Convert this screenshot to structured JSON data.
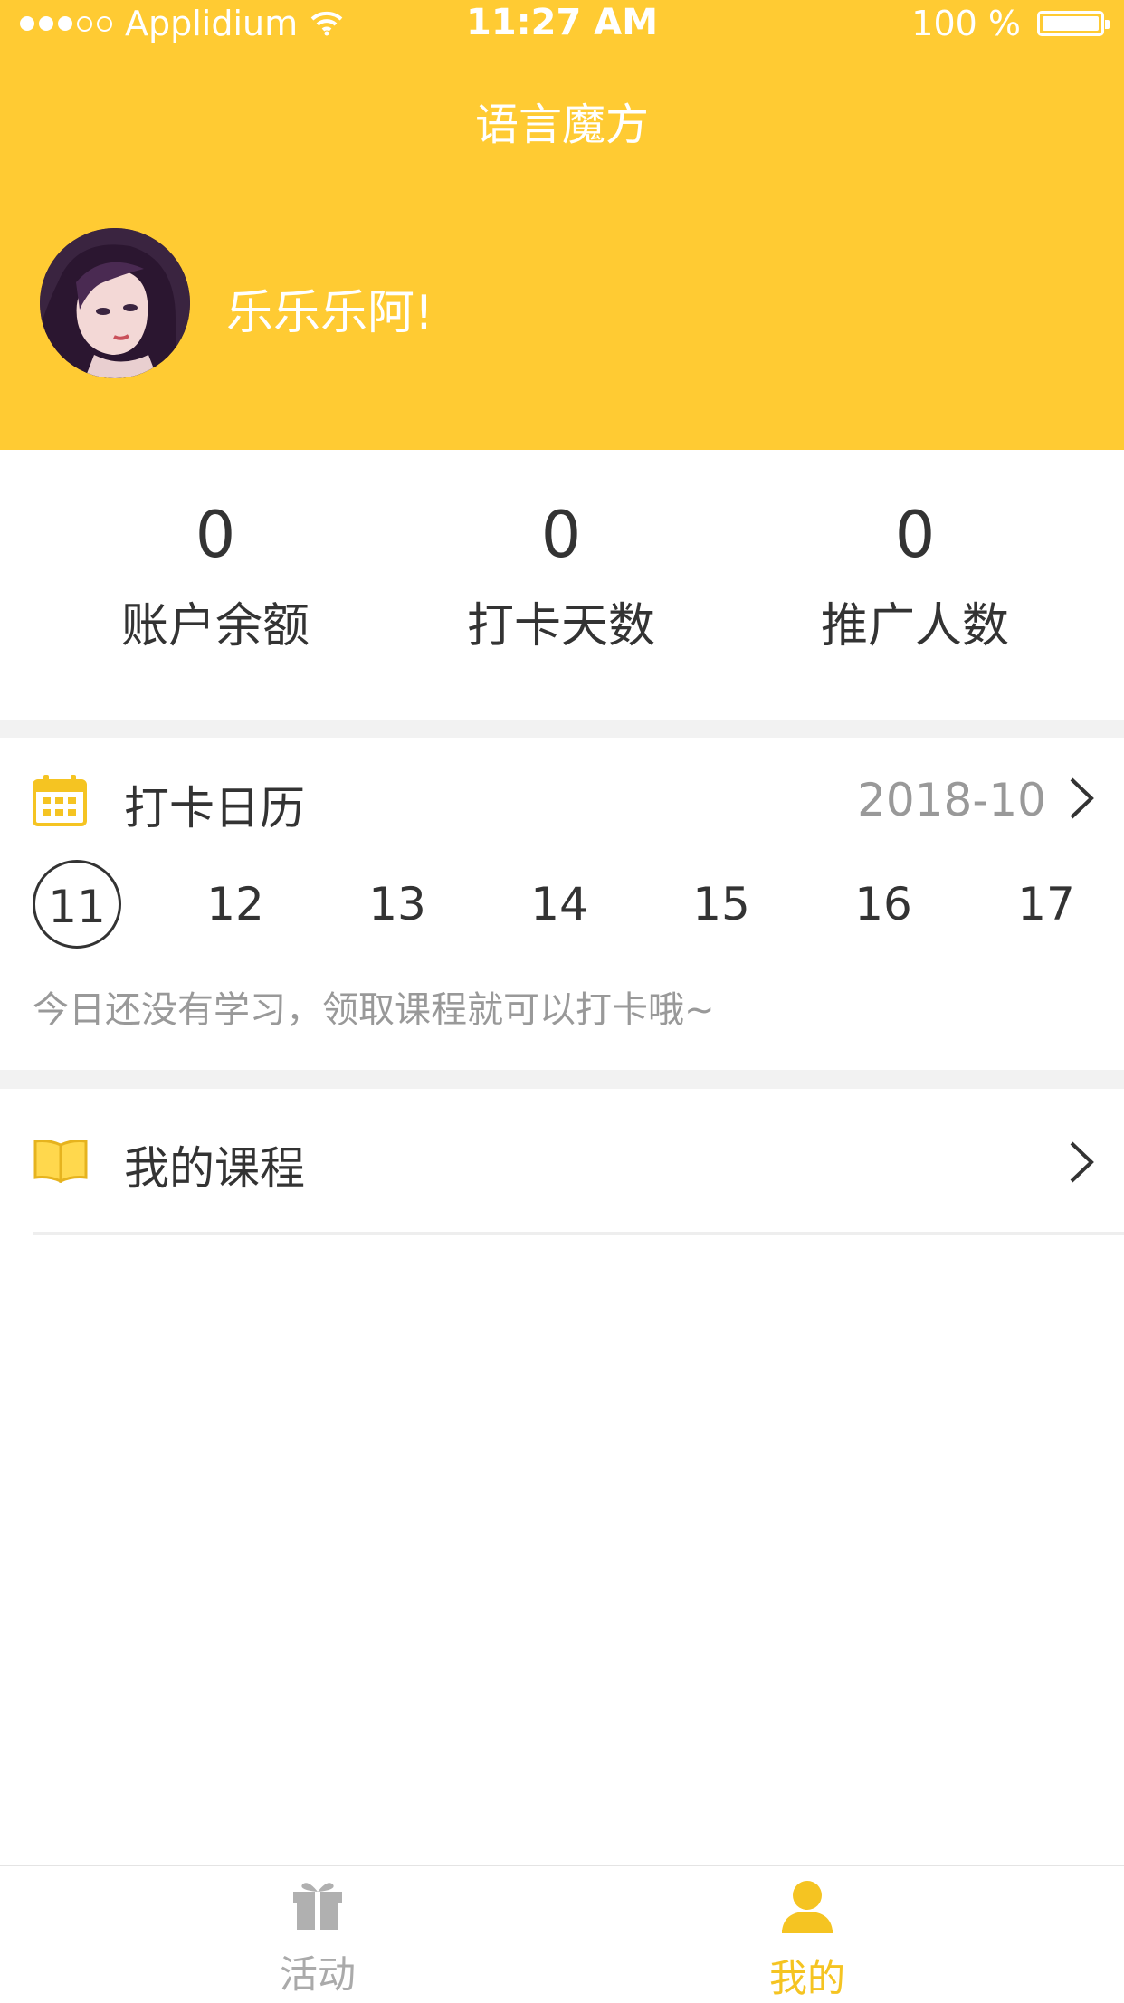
{
  "status_bar": {
    "carrier": "Applidium",
    "time": "11:27 AM",
    "battery": "100 %"
  },
  "header": {
    "title": "语言魔方",
    "username": "乐乐乐阿!"
  },
  "stats": [
    {
      "value": "0",
      "label": "账户余额"
    },
    {
      "value": "0",
      "label": "打卡天数"
    },
    {
      "value": "0",
      "label": "推广人数"
    }
  ],
  "calendar": {
    "title": "打卡日历",
    "month": "2018-10",
    "days": [
      "11",
      "12",
      "13",
      "14",
      "15",
      "16",
      "17"
    ],
    "today": "11",
    "hint": "今日还没有学习，领取课程就可以打卡哦~"
  },
  "courses": {
    "title": "我的课程"
  },
  "tabbar": {
    "tabs": [
      {
        "label": "活动",
        "icon": "gift-icon",
        "active": false
      },
      {
        "label": "我的",
        "icon": "user-icon",
        "active": true
      }
    ]
  },
  "colors": {
    "accent": "#ffcb33",
    "active_tab": "#f5c422",
    "inactive_tab": "#aaaaaa"
  }
}
